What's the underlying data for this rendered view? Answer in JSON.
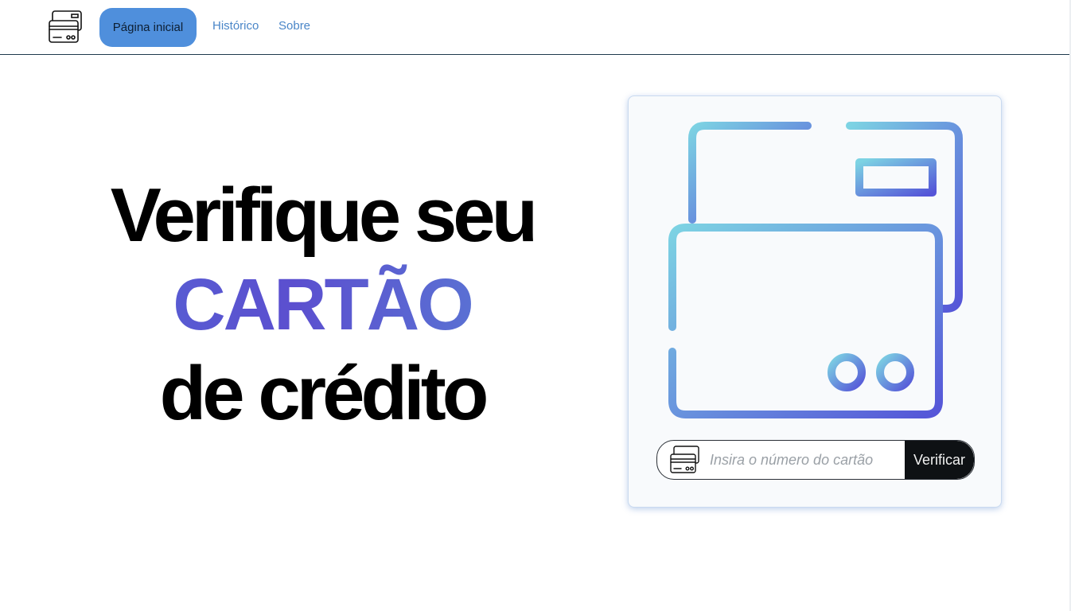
{
  "nav": {
    "logo_icon": "credit-card-icon",
    "items": [
      {
        "label": "Página inicial",
        "active": true
      },
      {
        "label": "Histórico",
        "active": false
      },
      {
        "label": "Sobre",
        "active": false
      }
    ],
    "active_color": "#4f8fdc",
    "link_color": "#4a86c8"
  },
  "hero": {
    "line1": "Verifique seu",
    "line2": "CARTÃO",
    "line3": "de crédito",
    "accent_colors": [
      "#5568d6",
      "#5b4fcf",
      "#5a8ad6"
    ]
  },
  "verify_card": {
    "illustration_icon": "credit-cards-icon",
    "gradient_colors": [
      "#7dd3e3",
      "#5555d8"
    ],
    "input_icon": "credit-card-icon",
    "input": {
      "value": "",
      "placeholder": "Insira o número do cartão"
    },
    "button_label": "Verificar"
  }
}
